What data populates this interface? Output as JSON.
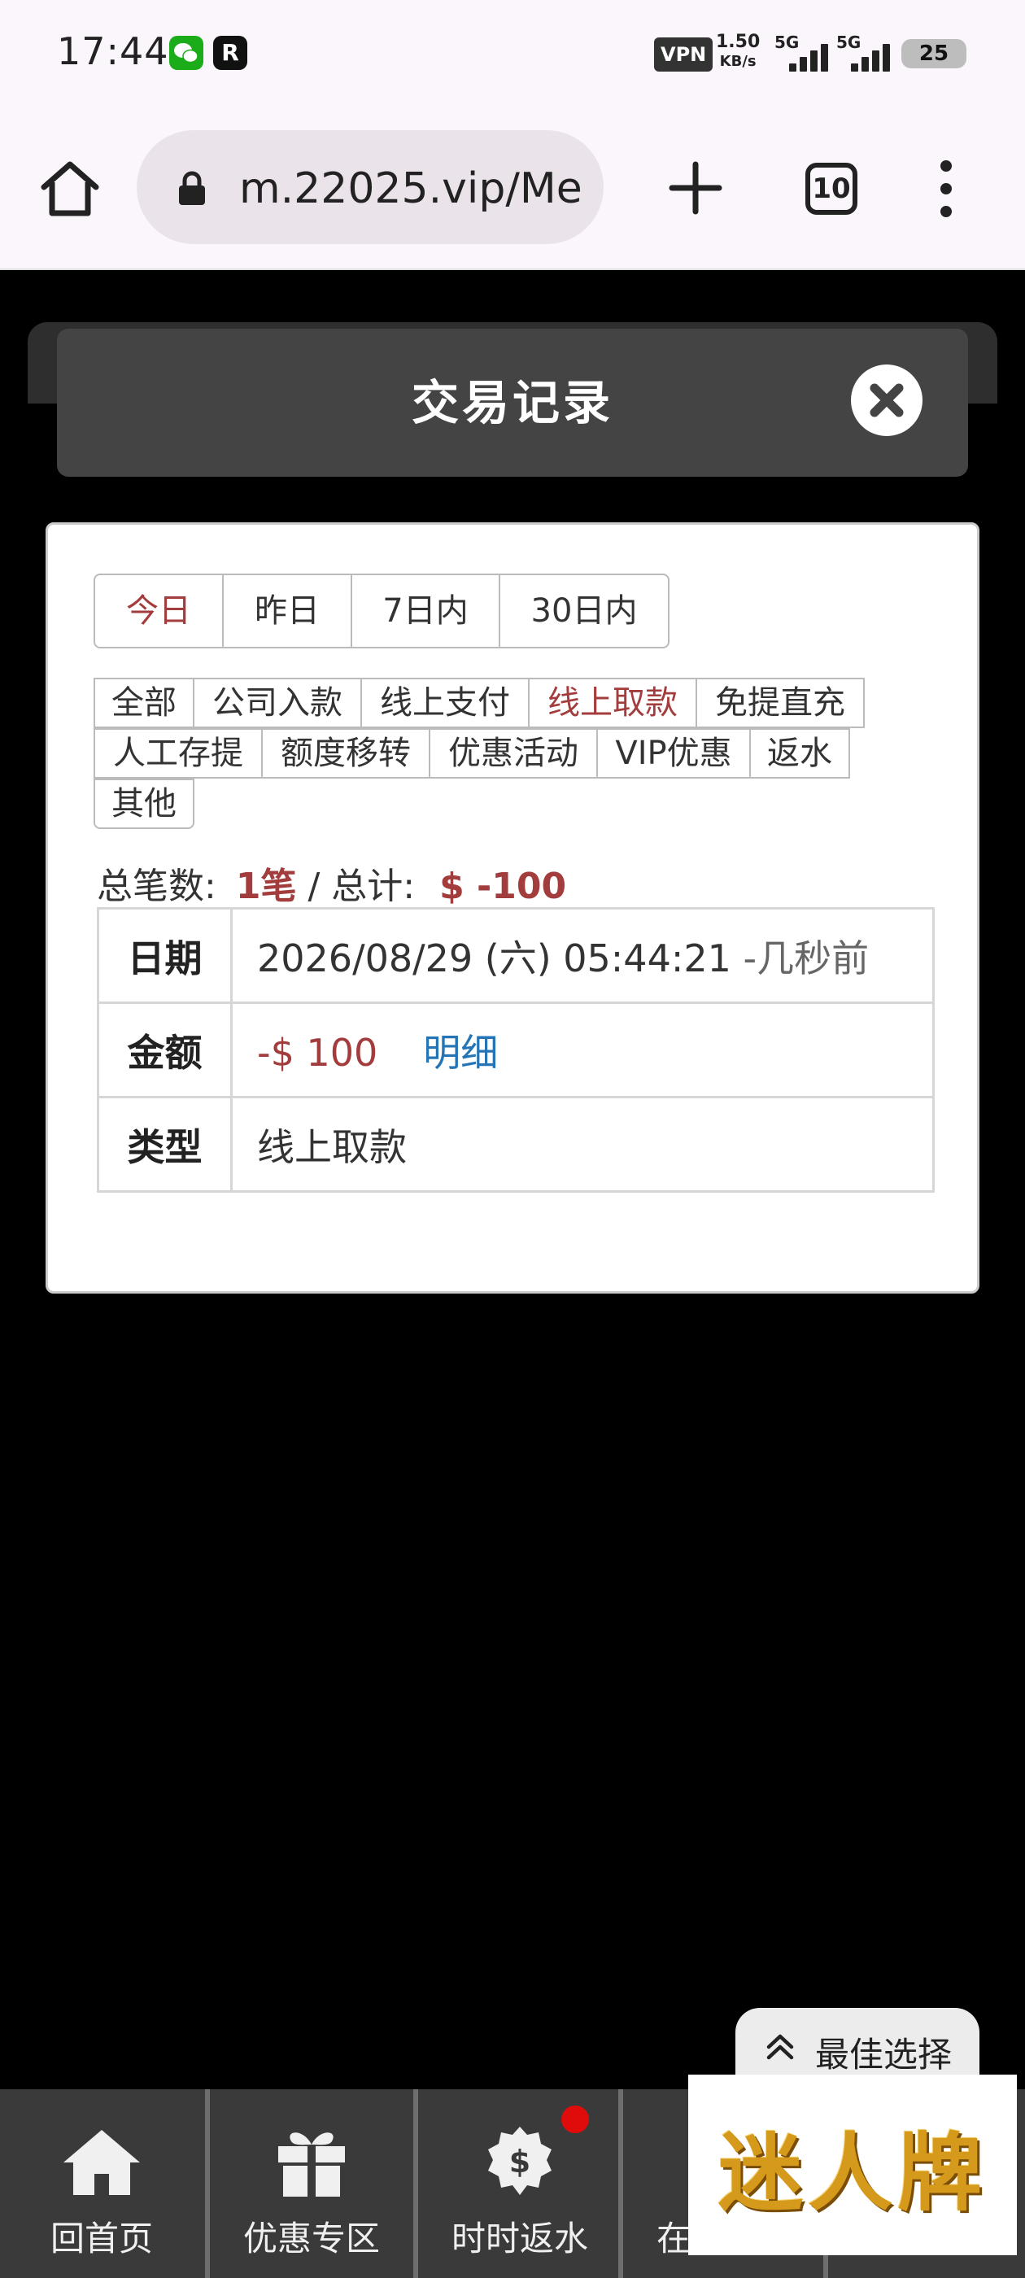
{
  "status_bar": {
    "time": "17:44",
    "app_icons": [
      "wechat-icon",
      "r-app-icon"
    ],
    "r_app_letter": "R",
    "vpn": "VPN",
    "net_speed_value": "1.50",
    "net_speed_unit": "KB/s",
    "sim1_label": "5G",
    "sim2_label": "5G",
    "battery": "25"
  },
  "browser": {
    "url": "m.22025.vip/Me",
    "tab_count": "10"
  },
  "modal": {
    "title": "交易记录",
    "date_filters": [
      {
        "label": "今日",
        "active": true
      },
      {
        "label": "昨日",
        "active": false
      },
      {
        "label": "7日内",
        "active": false
      },
      {
        "label": "30日内",
        "active": false
      }
    ],
    "type_filters": [
      {
        "label": "全部",
        "active": false
      },
      {
        "label": "公司入款",
        "active": false
      },
      {
        "label": "线上支付",
        "active": false
      },
      {
        "label": "线上取款",
        "active": true
      },
      {
        "label": "免提直充",
        "active": false
      },
      {
        "label": "人工存提",
        "active": false
      },
      {
        "label": "额度移转",
        "active": false
      },
      {
        "label": "优惠活动",
        "active": false
      },
      {
        "label": "VIP优惠",
        "active": false
      },
      {
        "label": "返水",
        "active": false
      },
      {
        "label": "其他",
        "active": false
      }
    ],
    "summary": {
      "count_label": "总笔数:",
      "count_value": "1笔",
      "separator": " / ",
      "total_label": "总计:",
      "total_value": "$ -100"
    },
    "record": {
      "date_label": "日期",
      "date_value": "2026/08/29 (六) 05:44:21",
      "date_relative": "-几秒前",
      "amount_label": "金额",
      "amount_value": "-$ 100",
      "detail_link": "明细",
      "type_label": "类型",
      "type_value": "线上取款"
    }
  },
  "floating": {
    "best_choice": "最佳选择",
    "logo_text": "迷人牌"
  },
  "bottom_nav": [
    {
      "label": "回首页",
      "icon": "home-icon"
    },
    {
      "label": "优惠专区",
      "icon": "gift-icon"
    },
    {
      "label": "时时返水",
      "icon": "dollar-badge-icon",
      "badge": true
    },
    {
      "label": "在线客服",
      "icon": "support-icon"
    }
  ]
}
